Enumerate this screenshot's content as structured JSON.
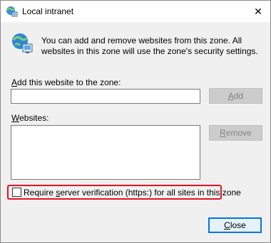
{
  "window": {
    "title": "Local intranet"
  },
  "header": {
    "description": "You can add and remove websites from this zone. All websites in this zone will use the zone's security settings."
  },
  "add_section": {
    "label_prefix": "",
    "label_mnemonic": "A",
    "label_rest": "dd this website to the zone:",
    "input_value": "",
    "add_button": {
      "mnemonic": "A",
      "rest": "dd",
      "enabled": false
    }
  },
  "websites_section": {
    "label_mnemonic": "W",
    "label_rest": "ebsites:",
    "items": [],
    "remove_button": {
      "mnemonic": "R",
      "rest": "emove",
      "enabled": false
    }
  },
  "https_checkbox": {
    "label_prefix": "Require ",
    "label_mnemonic": "s",
    "label_rest": "erver verification (https:) for all sites in this zone",
    "checked": false
  },
  "close_button": {
    "mnemonic": "C",
    "rest": "lose"
  },
  "colors": {
    "highlight": "#e81123",
    "default_border": "#0078d7"
  }
}
